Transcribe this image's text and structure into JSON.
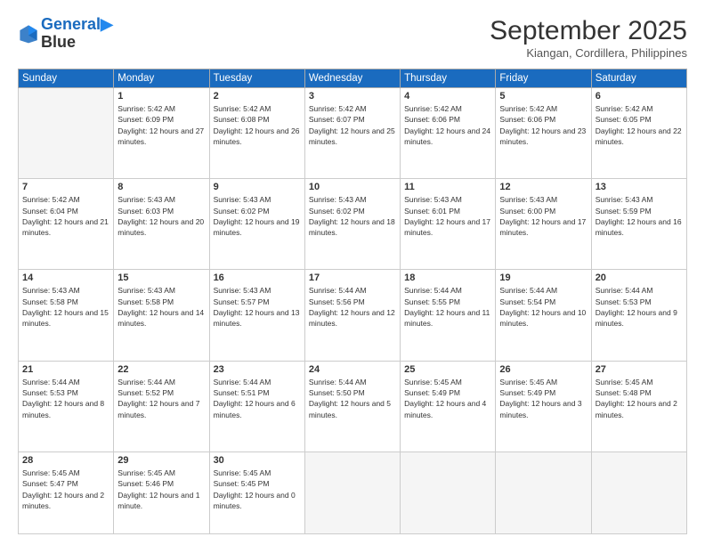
{
  "header": {
    "logo_line1": "General",
    "logo_line2": "Blue",
    "month": "September 2025",
    "location": "Kiangan, Cordillera, Philippines"
  },
  "weekdays": [
    "Sunday",
    "Monday",
    "Tuesday",
    "Wednesday",
    "Thursday",
    "Friday",
    "Saturday"
  ],
  "weeks": [
    [
      {
        "day": "",
        "empty": true
      },
      {
        "day": "1",
        "sunrise": "Sunrise: 5:42 AM",
        "sunset": "Sunset: 6:09 PM",
        "daylight": "Daylight: 12 hours and 27 minutes."
      },
      {
        "day": "2",
        "sunrise": "Sunrise: 5:42 AM",
        "sunset": "Sunset: 6:08 PM",
        "daylight": "Daylight: 12 hours and 26 minutes."
      },
      {
        "day": "3",
        "sunrise": "Sunrise: 5:42 AM",
        "sunset": "Sunset: 6:07 PM",
        "daylight": "Daylight: 12 hours and 25 minutes."
      },
      {
        "day": "4",
        "sunrise": "Sunrise: 5:42 AM",
        "sunset": "Sunset: 6:06 PM",
        "daylight": "Daylight: 12 hours and 24 minutes."
      },
      {
        "day": "5",
        "sunrise": "Sunrise: 5:42 AM",
        "sunset": "Sunset: 6:06 PM",
        "daylight": "Daylight: 12 hours and 23 minutes."
      },
      {
        "day": "6",
        "sunrise": "Sunrise: 5:42 AM",
        "sunset": "Sunset: 6:05 PM",
        "daylight": "Daylight: 12 hours and 22 minutes."
      }
    ],
    [
      {
        "day": "7",
        "sunrise": "Sunrise: 5:42 AM",
        "sunset": "Sunset: 6:04 PM",
        "daylight": "Daylight: 12 hours and 21 minutes."
      },
      {
        "day": "8",
        "sunrise": "Sunrise: 5:43 AM",
        "sunset": "Sunset: 6:03 PM",
        "daylight": "Daylight: 12 hours and 20 minutes."
      },
      {
        "day": "9",
        "sunrise": "Sunrise: 5:43 AM",
        "sunset": "Sunset: 6:02 PM",
        "daylight": "Daylight: 12 hours and 19 minutes."
      },
      {
        "day": "10",
        "sunrise": "Sunrise: 5:43 AM",
        "sunset": "Sunset: 6:02 PM",
        "daylight": "Daylight: 12 hours and 18 minutes."
      },
      {
        "day": "11",
        "sunrise": "Sunrise: 5:43 AM",
        "sunset": "Sunset: 6:01 PM",
        "daylight": "Daylight: 12 hours and 17 minutes."
      },
      {
        "day": "12",
        "sunrise": "Sunrise: 5:43 AM",
        "sunset": "Sunset: 6:00 PM",
        "daylight": "Daylight: 12 hours and 17 minutes."
      },
      {
        "day": "13",
        "sunrise": "Sunrise: 5:43 AM",
        "sunset": "Sunset: 5:59 PM",
        "daylight": "Daylight: 12 hours and 16 minutes."
      }
    ],
    [
      {
        "day": "14",
        "sunrise": "Sunrise: 5:43 AM",
        "sunset": "Sunset: 5:58 PM",
        "daylight": "Daylight: 12 hours and 15 minutes."
      },
      {
        "day": "15",
        "sunrise": "Sunrise: 5:43 AM",
        "sunset": "Sunset: 5:58 PM",
        "daylight": "Daylight: 12 hours and 14 minutes."
      },
      {
        "day": "16",
        "sunrise": "Sunrise: 5:43 AM",
        "sunset": "Sunset: 5:57 PM",
        "daylight": "Daylight: 12 hours and 13 minutes."
      },
      {
        "day": "17",
        "sunrise": "Sunrise: 5:44 AM",
        "sunset": "Sunset: 5:56 PM",
        "daylight": "Daylight: 12 hours and 12 minutes."
      },
      {
        "day": "18",
        "sunrise": "Sunrise: 5:44 AM",
        "sunset": "Sunset: 5:55 PM",
        "daylight": "Daylight: 12 hours and 11 minutes."
      },
      {
        "day": "19",
        "sunrise": "Sunrise: 5:44 AM",
        "sunset": "Sunset: 5:54 PM",
        "daylight": "Daylight: 12 hours and 10 minutes."
      },
      {
        "day": "20",
        "sunrise": "Sunrise: 5:44 AM",
        "sunset": "Sunset: 5:53 PM",
        "daylight": "Daylight: 12 hours and 9 minutes."
      }
    ],
    [
      {
        "day": "21",
        "sunrise": "Sunrise: 5:44 AM",
        "sunset": "Sunset: 5:53 PM",
        "daylight": "Daylight: 12 hours and 8 minutes."
      },
      {
        "day": "22",
        "sunrise": "Sunrise: 5:44 AM",
        "sunset": "Sunset: 5:52 PM",
        "daylight": "Daylight: 12 hours and 7 minutes."
      },
      {
        "day": "23",
        "sunrise": "Sunrise: 5:44 AM",
        "sunset": "Sunset: 5:51 PM",
        "daylight": "Daylight: 12 hours and 6 minutes."
      },
      {
        "day": "24",
        "sunrise": "Sunrise: 5:44 AM",
        "sunset": "Sunset: 5:50 PM",
        "daylight": "Daylight: 12 hours and 5 minutes."
      },
      {
        "day": "25",
        "sunrise": "Sunrise: 5:45 AM",
        "sunset": "Sunset: 5:49 PM",
        "daylight": "Daylight: 12 hours and 4 minutes."
      },
      {
        "day": "26",
        "sunrise": "Sunrise: 5:45 AM",
        "sunset": "Sunset: 5:49 PM",
        "daylight": "Daylight: 12 hours and 3 minutes."
      },
      {
        "day": "27",
        "sunrise": "Sunrise: 5:45 AM",
        "sunset": "Sunset: 5:48 PM",
        "daylight": "Daylight: 12 hours and 2 minutes."
      }
    ],
    [
      {
        "day": "28",
        "sunrise": "Sunrise: 5:45 AM",
        "sunset": "Sunset: 5:47 PM",
        "daylight": "Daylight: 12 hours and 2 minutes."
      },
      {
        "day": "29",
        "sunrise": "Sunrise: 5:45 AM",
        "sunset": "Sunset: 5:46 PM",
        "daylight": "Daylight: 12 hours and 1 minute."
      },
      {
        "day": "30",
        "sunrise": "Sunrise: 5:45 AM",
        "sunset": "Sunset: 5:45 PM",
        "daylight": "Daylight: 12 hours and 0 minutes."
      },
      {
        "day": "",
        "empty": true
      },
      {
        "day": "",
        "empty": true
      },
      {
        "day": "",
        "empty": true
      },
      {
        "day": "",
        "empty": true
      }
    ]
  ]
}
